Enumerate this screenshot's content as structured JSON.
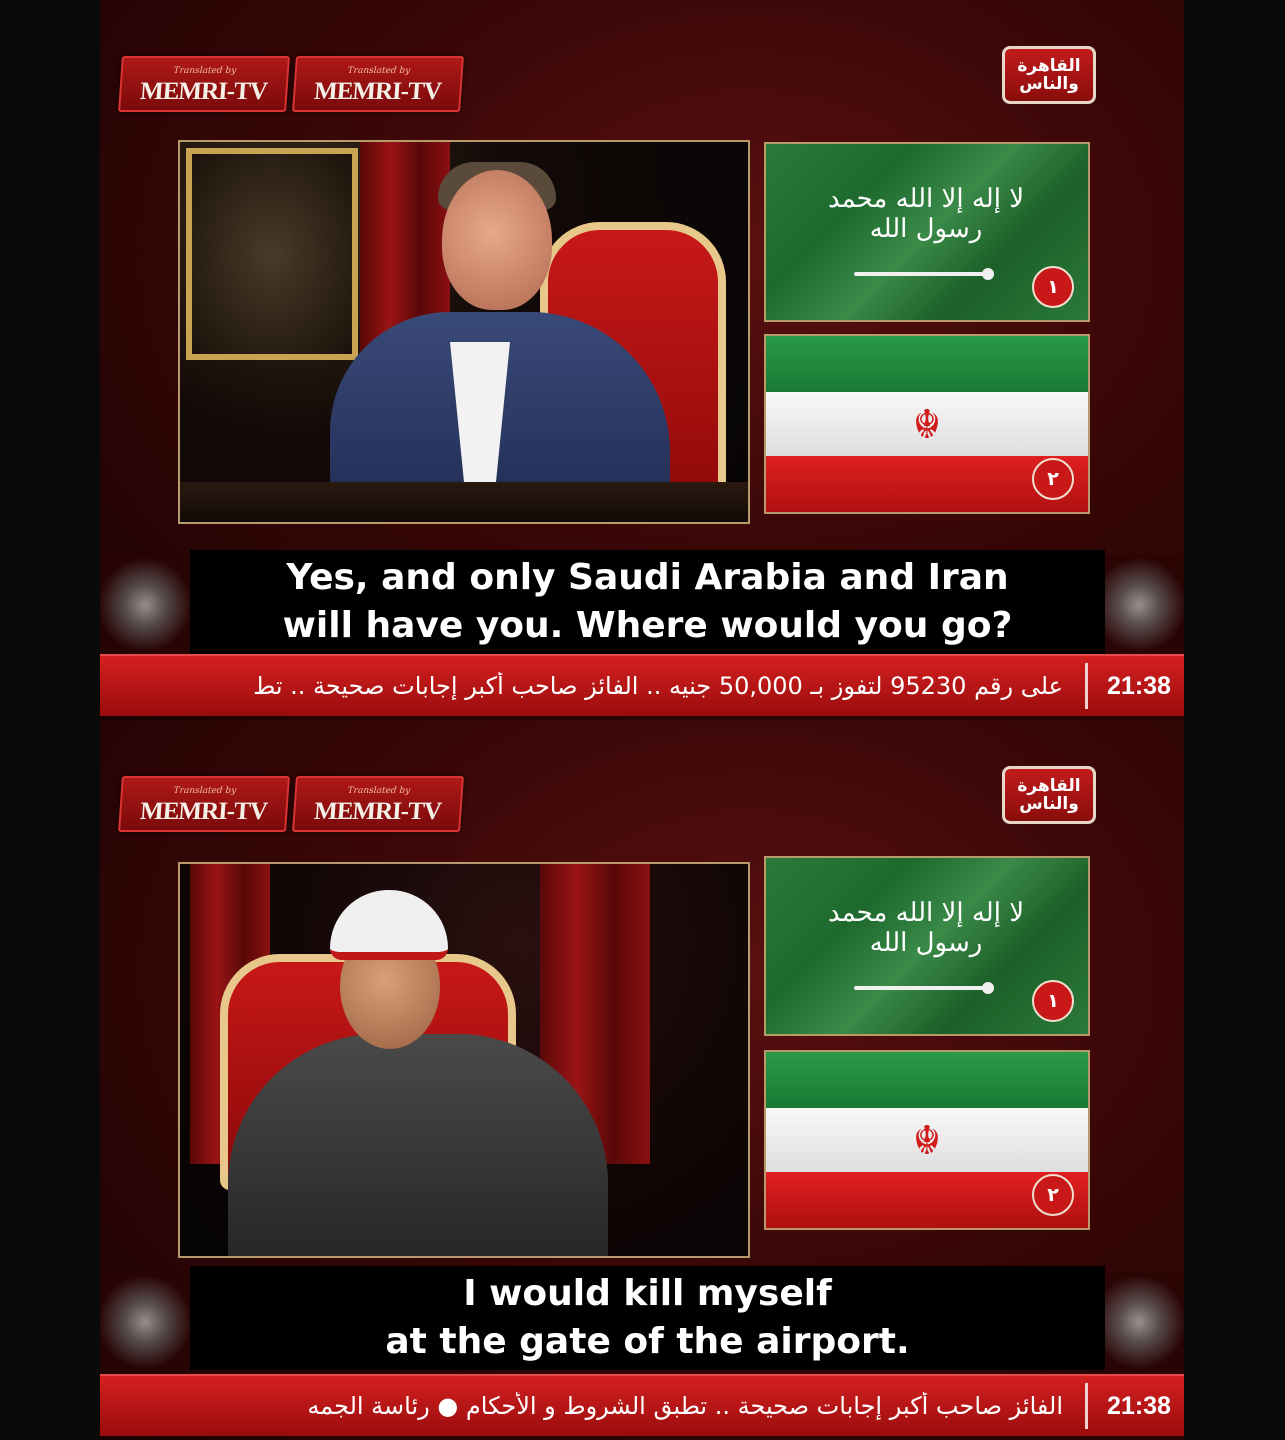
{
  "panels": [
    {
      "memri_labels": [
        {
          "small": "Translated by",
          "big": "MEMRI-TV"
        },
        {
          "small": "Translated by",
          "big": "MEMRI-TV"
        }
      ],
      "channel_logo": [
        "القاهرة",
        "والناس"
      ],
      "flags": [
        {
          "name": "saudi-arabia",
          "text": "لا إله إلا الله محمد رسول الله",
          "number": "١"
        },
        {
          "name": "iran",
          "emblem": "☬",
          "number": "٢"
        }
      ],
      "subtitle": [
        "Yes, and only Saudi Arabia and Iran",
        "will have you. Where would you go?"
      ],
      "ticker_text": "على رقم 95230 لتفوز بـ 50,000 جنيه .. الفائز صاحب أكبر إجابات صحيحة .. تط",
      "time": "21:38"
    },
    {
      "memri_labels": [
        {
          "small": "Translated by",
          "big": "MEMRI-TV"
        },
        {
          "small": "Translated by",
          "big": "MEMRI-TV"
        }
      ],
      "channel_logo": [
        "القاهرة",
        "والناس"
      ],
      "flags": [
        {
          "name": "saudi-arabia",
          "text": "لا إله إلا الله محمد رسول الله",
          "number": "١"
        },
        {
          "name": "iran",
          "emblem": "☬",
          "number": "٢"
        }
      ],
      "subtitle": [
        "I would kill myself",
        "at the gate of the airport."
      ],
      "ticker_text": "الفائز صاحب أكبر إجابات صحيحة .. تطبق الشروط و الأحكام ● رئاسة الجمه",
      "time": "21:38"
    }
  ],
  "colors": {
    "ticker_red": "#c81818",
    "background_dark_red": "#3a0707",
    "saudi_green": "#1e6a2e",
    "iran_red": "#d21c1c"
  }
}
